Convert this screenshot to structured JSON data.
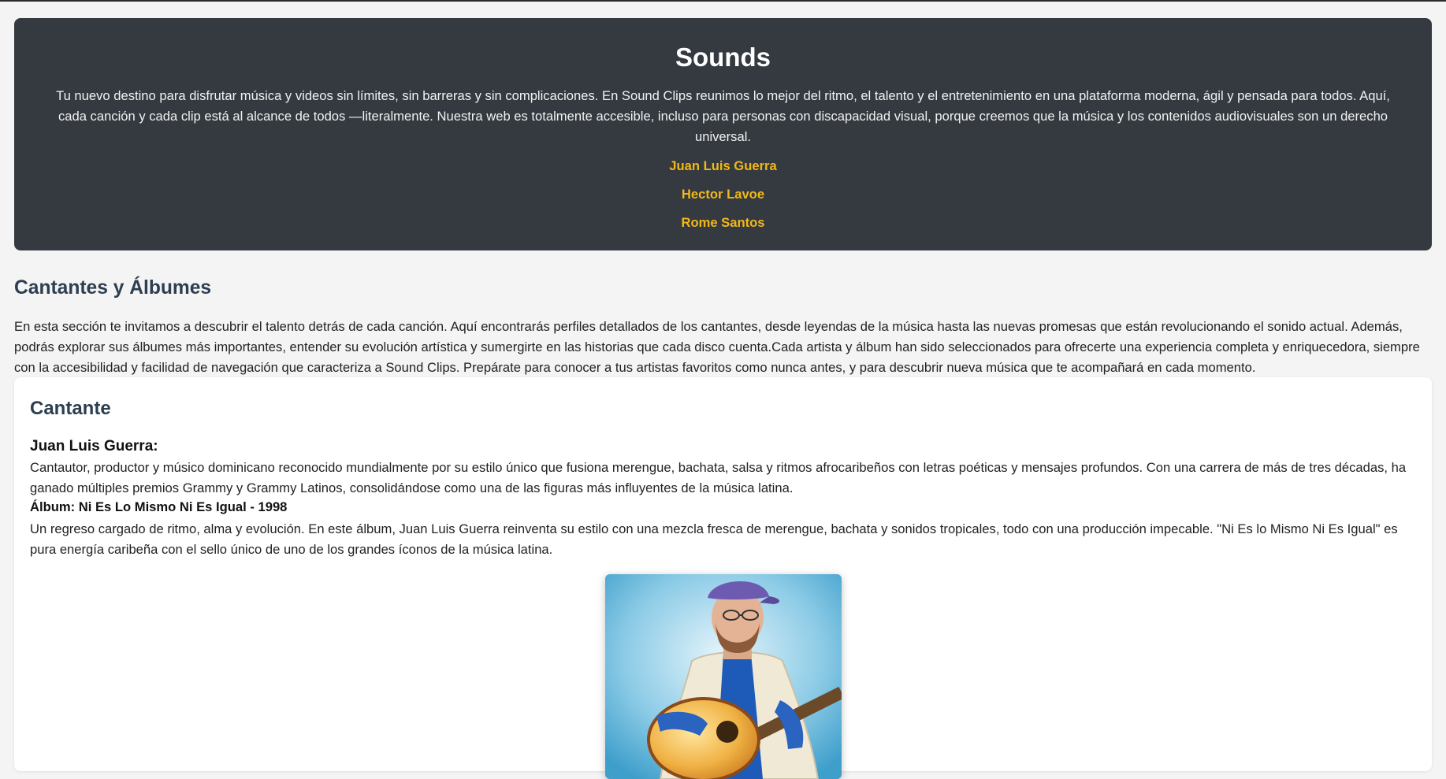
{
  "hero": {
    "title": "Sounds",
    "description": "Tu nuevo destino para disfrutar música y videos sin límites, sin barreras y sin complicaciones. En Sound Clips reunimos lo mejor del ritmo, el talento y el entretenimiento en una plataforma moderna, ágil y pensada para todos. Aquí, cada canción y cada clip está al alcance de todos —literalmente. Nuestra web es totalmente accesible, incluso para personas con discapacidad visual, porque creemos que la música y los contenidos audiovisuales son un derecho universal.",
    "links": [
      "Juan Luis Guerra",
      "Hector Lavoe",
      "Rome Santos"
    ],
    "link_color": "#f2b816",
    "background": "#343a40"
  },
  "section": {
    "title": "Cantantes y Álbumes",
    "intro": "En esta sección te invitamos a descubrir el talento detrás de cada canción. Aquí encontrarás perfiles detallados de los cantantes, desde leyendas de la música hasta las nuevas promesas que están revolucionando el sonido actual. Además, podrás explorar sus álbumes más importantes, entender su evolución artística y sumergirte en las historias que cada disco cuenta.Cada artista y álbum han sido seleccionados para ofrecerte una experiencia completa y enriquecedora, siempre con la accesibilidad y facilidad de navegación que caracteriza a Sound Clips. Prepárate para conocer a tus artistas favoritos como nunca antes, y para descubrir nueva música que te acompañará en cada momento."
  },
  "card": {
    "heading": "Cantante",
    "artist": "Juan Luis Guerra:",
    "bio": "Cantautor, productor y músico dominicano reconocido mundialmente por su estilo único que fusiona merengue, bachata, salsa y ritmos afrocaribeños con letras poéticas y mensajes profundos. Con una carrera de más de tres décadas, ha ganado múltiples premios Grammy y Grammy Latinos, consolidándose como una de las figuras más influyentes de la música latina.",
    "album": "Álbum: Ni Es Lo Mismo Ni Es Igual - 1998",
    "album_description": "Un regreso cargado de ritmo, alma y evolución. En este álbum, Juan Luis Guerra reinventa su estilo con una mezcla fresca de merengue, bachata y sonidos tropicales, todo con una producción impecable. \"Ni Es lo Mismo Ni Es Igual\" es pura energía caribeña con el sello único de uno de los grandes íconos de la música latina.",
    "heading_color": "#2c3e50"
  }
}
